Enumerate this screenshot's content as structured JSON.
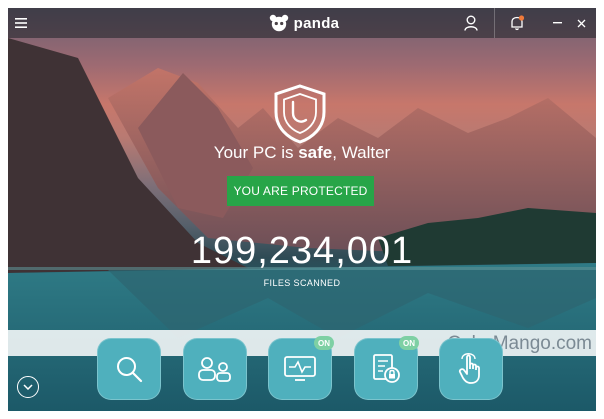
{
  "app": {
    "brand": "panda"
  },
  "main": {
    "headline_prefix": "Your PC is ",
    "headline_bold": "safe",
    "headline_suffix": ", Walter",
    "status_button": "YOU ARE PROTECTED",
    "files_scanned_count": "199,234,001",
    "files_scanned_label": "FILES SCANNED"
  },
  "features": [
    {
      "icon": "search-icon",
      "badge": ""
    },
    {
      "icon": "users-icon",
      "badge": ""
    },
    {
      "icon": "monitor-activity-icon",
      "badge": "ON"
    },
    {
      "icon": "document-lock-icon",
      "badge": "ON"
    },
    {
      "icon": "touch-hand-icon",
      "badge": ""
    }
  ],
  "watermark": "ColorMango.com",
  "colors": {
    "protected_green": "#27a548",
    "feature_tile": "#4fb0bd",
    "on_badge": "#7ed0a4",
    "notification_dot": "#f07a3a"
  }
}
